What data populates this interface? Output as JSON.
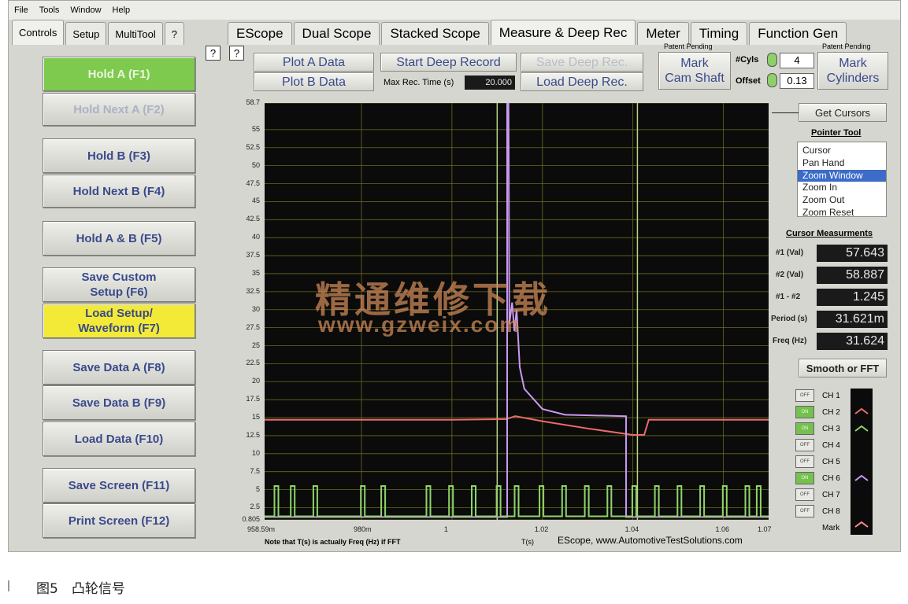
{
  "menu": [
    "File",
    "Tools",
    "Window",
    "Help"
  ],
  "left_tabs": [
    "Controls",
    "Setup",
    "MultiTool",
    "?"
  ],
  "main_tabs": [
    "EScope",
    "Dual Scope",
    "Stacked Scope",
    "Measure & Deep Rec",
    "Meter",
    "Timing",
    "Function Gen"
  ],
  "left_buttons": {
    "hold_a": "Hold A (F1)",
    "hold_next_a": "Hold Next A (F2)",
    "hold_b": "Hold B (F3)",
    "hold_next_b": "Hold Next B (F4)",
    "hold_ab": "Hold A & B (F5)",
    "save_custom_1": "Save Custom",
    "save_custom_2": "Setup (F6)",
    "load_setup_1": "Load Setup/",
    "load_setup_2": "Waveform (F7)",
    "save_a": "Save Data A (F8)",
    "save_b": "Save Data B (F9)",
    "load_data": "Load Data (F10)",
    "save_screen": "Save Screen (F11)",
    "print_screen": "Print Screen (F12)"
  },
  "toolbar": {
    "help": "?",
    "plot_a": "Plot A Data",
    "plot_b": "Plot B Data",
    "start_deep": "Start Deep Record",
    "save_deep": "Save Deep Rec.",
    "load_deep": "Load Deep Rec.",
    "max_rec_label": "Max Rec. Time (s)",
    "max_rec_value": "20.000",
    "patent_1": "Patent Pending",
    "mark_cam_1": "Mark",
    "mark_cam_2": "Cam Shaft",
    "cyls_label": "#Cyls",
    "cyls_value": "4",
    "offset_label": "Offset",
    "offset_value": "0.13",
    "patent_2": "Patent Pending",
    "mark_cyl_1": "Mark",
    "mark_cyl_2": "Cylinders"
  },
  "right_panel": {
    "get_cursors": "Get Cursors",
    "pointer_tool": "Pointer Tool",
    "pointer_options": [
      "Cursor",
      "Pan Hand",
      "Zoom Window",
      "Zoom In",
      "Zoom Out",
      "Zoom Reset"
    ],
    "pointer_selected": "Zoom Window",
    "cursor_meas_title": "Cursor Measurments",
    "measurements": [
      {
        "label": "#1 (Val)",
        "value": "57.643"
      },
      {
        "label": "#2 (Val)",
        "value": "58.887"
      },
      {
        "label": "#1 - #2",
        "value": "1.245"
      },
      {
        "label": "Period (s)",
        "value": "31.621m"
      },
      {
        "label": "Freq (Hz)",
        "value": "31.624"
      }
    ],
    "smooth_fft": "Smooth or FFT",
    "channels": [
      {
        "state": "OFF",
        "name": "CH 1"
      },
      {
        "state": "ON",
        "name": "CH 2"
      },
      {
        "state": "ON",
        "name": "CH 3"
      },
      {
        "state": "OFF",
        "name": "CH 4"
      },
      {
        "state": "OFF",
        "name": "CH 5"
      },
      {
        "state": "ON",
        "name": "CH 6"
      },
      {
        "state": "OFF",
        "name": "CH 7"
      },
      {
        "state": "OFF",
        "name": "CH 8"
      }
    ],
    "mark_label": "Mark"
  },
  "chart_data": {
    "type": "line",
    "y_ticks": [
      "58.7",
      "55",
      "52.5",
      "50",
      "47.5",
      "45",
      "42.5",
      "40",
      "37.5",
      "35",
      "32.5",
      "30",
      "27.5",
      "25",
      "22.5",
      "20",
      "17.5",
      "15",
      "12.5",
      "10",
      "7.5",
      "5",
      "2.5",
      "0.805"
    ],
    "x_ticks": [
      "958.59m",
      "980m",
      "1",
      "1.02",
      "1.04",
      "1.06",
      "1.07"
    ],
    "x_axis_label": "T(s)",
    "ylim": [
      0.805,
      58.7
    ],
    "xlim": [
      0.95859,
      1.07
    ],
    "series": [
      {
        "color": "#ee6a6a",
        "points": [
          [
            0.95859,
            14.7
          ],
          [
            1.0,
            14.7
          ],
          [
            1.012,
            14.8
          ],
          [
            1.014,
            15.2
          ],
          [
            1.02,
            14.5
          ],
          [
            1.03,
            13.5
          ],
          [
            1.04,
            12.6
          ],
          [
            1.0425,
            12.6
          ],
          [
            1.0435,
            14.7
          ],
          [
            1.07,
            14.7
          ]
        ]
      },
      {
        "color": "#c89af0",
        "points": [
          [
            0.95859,
            1.2
          ],
          [
            1.0122,
            1.2
          ],
          [
            1.0122,
            58.7
          ],
          [
            1.0125,
            58.7
          ],
          [
            1.0127,
            28
          ],
          [
            1.0133,
            31
          ],
          [
            1.0138,
            27
          ],
          [
            1.0143,
            30
          ],
          [
            1.015,
            22
          ],
          [
            1.016,
            19
          ],
          [
            1.02,
            16.2
          ],
          [
            1.025,
            15.4
          ],
          [
            1.0385,
            15.2
          ],
          [
            1.0385,
            1.2
          ],
          [
            1.07,
            1.2
          ]
        ]
      },
      {
        "color": "#8fd46a",
        "pulses": [
          0.9612,
          0.9648,
          0.9698,
          0.9803,
          0.9848,
          0.9948,
          0.9998,
          1.0048,
          1.0103,
          1.0143,
          1.0198,
          1.0248,
          1.0298,
          1.0348,
          1.0403,
          1.0453,
          1.0503,
          1.0553,
          1.0603,
          1.0653,
          1.0678
        ],
        "low": 1.3,
        "high": 5.5
      }
    ],
    "cursors": [
      1.01,
      1.041
    ]
  },
  "plot_footer": {
    "note": "Note that T(s) is actually Freq (Hz) if FFT",
    "credit": "EScope, www.AutomotiveTestSolutions.com"
  },
  "watermark": {
    "line1": "精通维修下载",
    "line2": "www.gzweix.com"
  },
  "caption": "图5　凸轮信号"
}
